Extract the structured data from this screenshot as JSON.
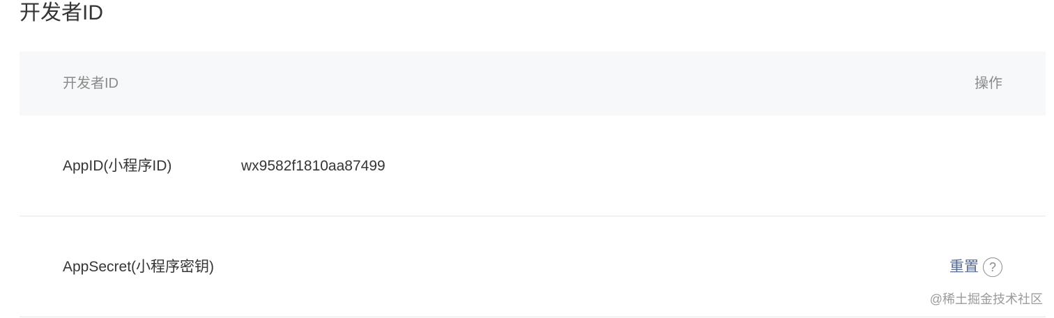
{
  "page": {
    "title": "开发者ID"
  },
  "table": {
    "header": {
      "id_column": "开发者ID",
      "action_column": "操作"
    },
    "rows": [
      {
        "label": "AppID(小程序ID)",
        "value": "wx9582f1810aa87499",
        "action": ""
      },
      {
        "label": "AppSecret(小程序密钥)",
        "value": "",
        "action": "重置",
        "help_icon": "question-circle-icon",
        "help_glyph": "?"
      }
    ]
  },
  "watermark": "@稀土掘金技术社区",
  "colors": {
    "header_bg": "#f6f8f9",
    "link": "#576b95",
    "text": "#353535",
    "muted": "#8a8a8a"
  }
}
